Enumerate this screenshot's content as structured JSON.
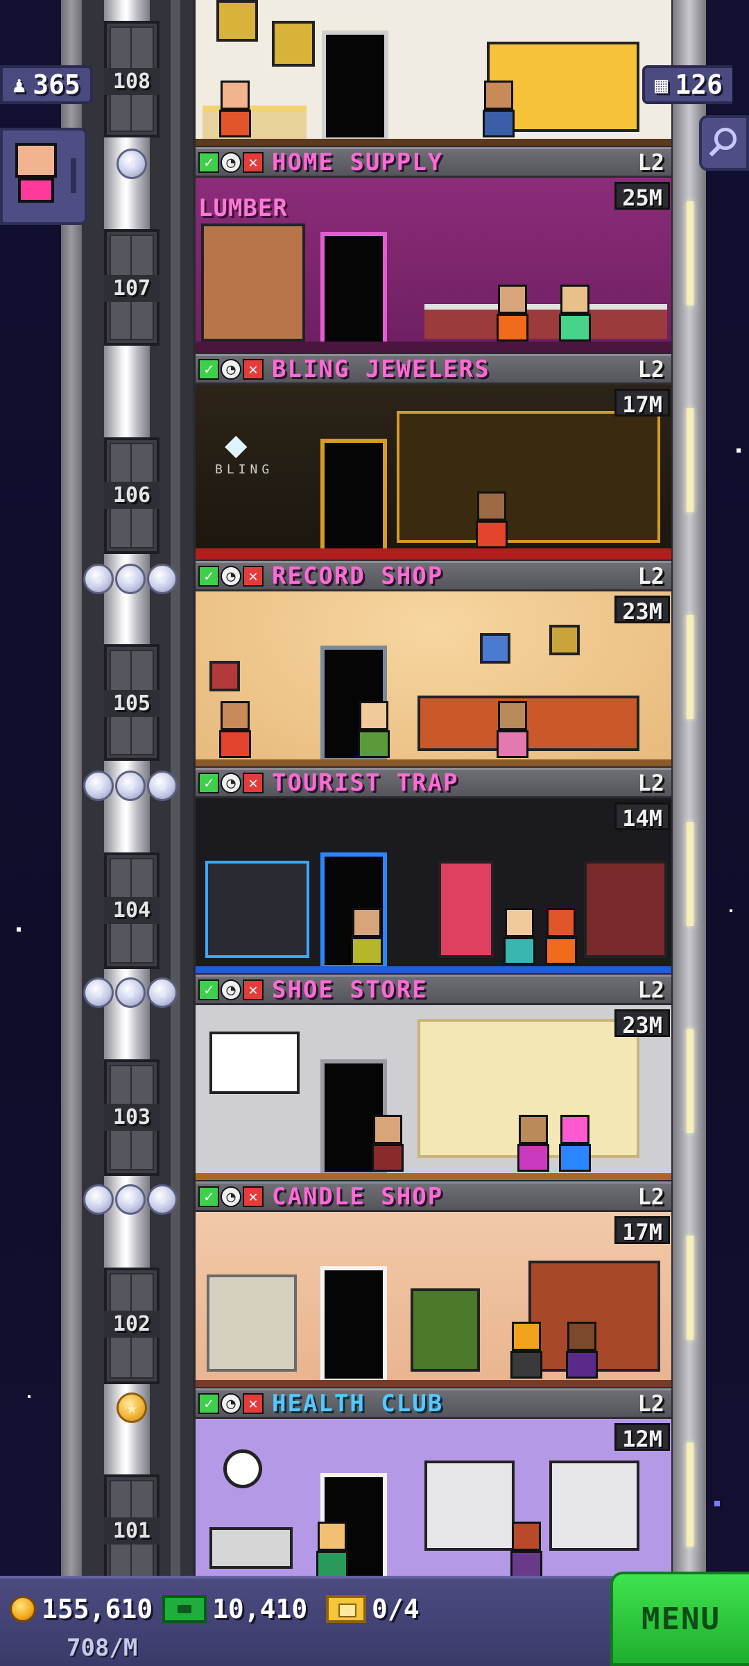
{
  "hud": {
    "population": "365",
    "floors": "126"
  },
  "floor_numbers": [
    "108",
    "107",
    "106",
    "105",
    "104",
    "103",
    "102",
    "101"
  ],
  "stores": [
    {
      "name": "HOME SUPPLY",
      "level": "L2",
      "value": "25M",
      "status_icons": [
        "check-icon",
        "clock-icon",
        "cross-icon"
      ],
      "name_color": "#ff6bd6",
      "sign": "LUMBER"
    },
    {
      "name": "BLING JEWELERS",
      "level": "L2",
      "value": "17M",
      "status_icons": [
        "check-icon",
        "clock-icon",
        "cross-icon"
      ],
      "name_color": "#ff6bd6",
      "sign": "BLING"
    },
    {
      "name": "RECORD SHOP",
      "level": "L2",
      "value": "23M",
      "status_icons": [
        "check-icon",
        "clock-icon",
        "cross-icon"
      ],
      "name_color": "#ff6bd6"
    },
    {
      "name": "TOURIST TRAP",
      "level": "L2",
      "value": "14M",
      "status_icons": [
        "check-icon",
        "clock-icon",
        "cross-icon"
      ],
      "name_color": "#ff6bd6"
    },
    {
      "name": "SHOE STORE",
      "level": "L2",
      "value": "23M",
      "status_icons": [
        "check-icon",
        "clock-icon",
        "cross-icon"
      ],
      "name_color": "#ff6bd6"
    },
    {
      "name": "CANDLE SHOP",
      "level": "L2",
      "value": "17M",
      "status_icons": [
        "check-icon",
        "clock-icon",
        "cross-icon"
      ],
      "name_color": "#ff6bd6"
    },
    {
      "name": "HEALTH CLUB",
      "level": "L2",
      "value": "12M",
      "status_icons": [
        "check-icon",
        "clock-icon",
        "cross-icon"
      ],
      "name_color": "#55c9ff"
    }
  ],
  "bottom": {
    "coins": "155,610",
    "tower_bux": "10,410",
    "tickets": "0/4",
    "rate": "708/M",
    "menu_label": "MENU"
  },
  "colors": {
    "accent_green": "#3ed04b",
    "hud_blue": "#4a4a7e",
    "name_pink": "#ff6bd6",
    "name_blue": "#55c9ff"
  }
}
